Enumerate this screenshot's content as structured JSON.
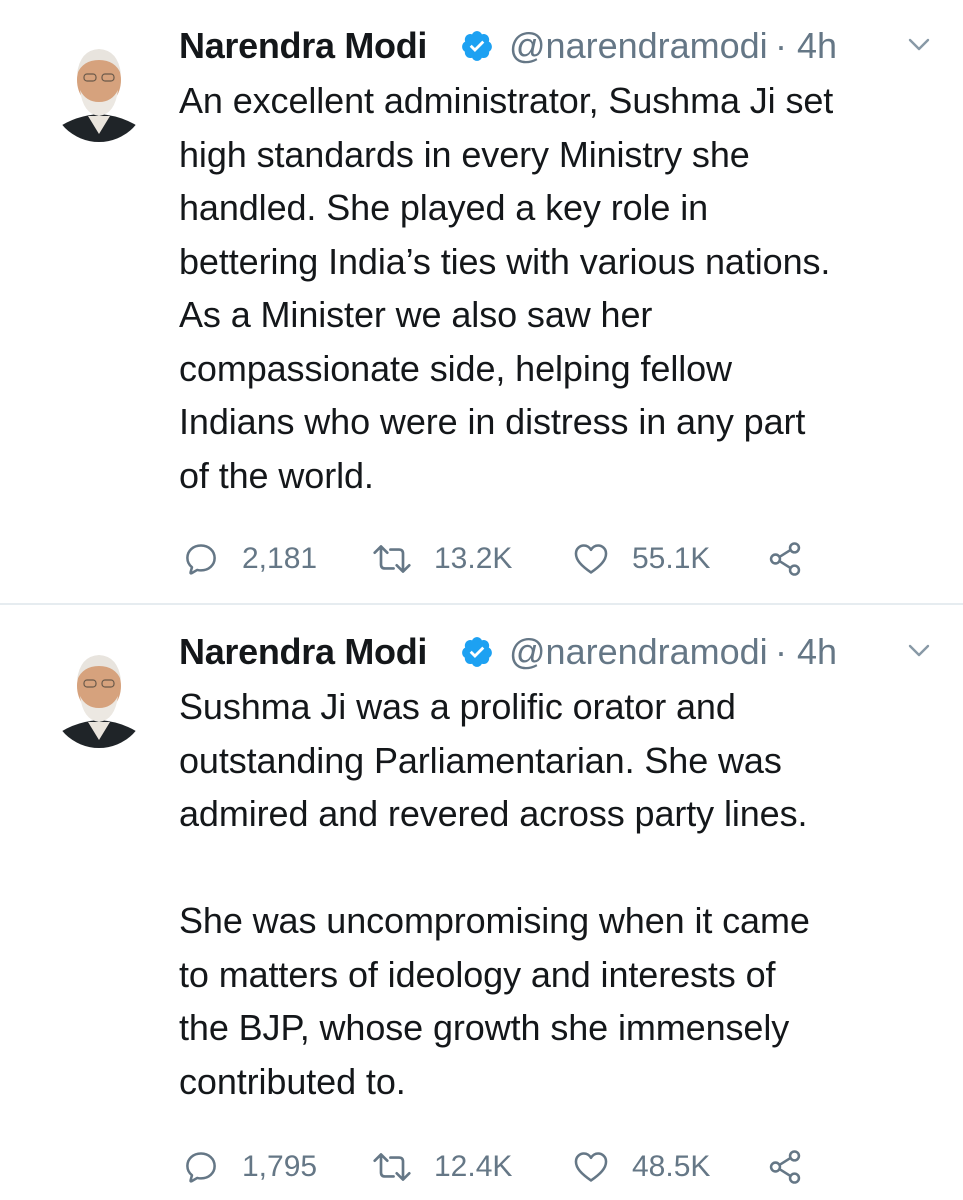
{
  "tweets": [
    {
      "author": {
        "name": "Narendra Modi",
        "handle": "@narendramodi",
        "verified": true
      },
      "separator": "·",
      "time": "4h",
      "body": [
        "An excellent administrator, Sushma Ji set\nhigh standards in every Ministry she\nhandled. She played a key role in\nbettering India’s ties with various nations.\nAs a Minister we also saw her\ncompassionate side, helping fellow\nIndians who were in distress in any part\nof the world."
      ],
      "stats": {
        "replies": "2,181",
        "retweets": "13.2K",
        "likes": "55.1K"
      }
    },
    {
      "author": {
        "name": "Narendra Modi",
        "handle": "@narendramodi",
        "verified": true
      },
      "separator": "·",
      "time": "4h",
      "body": [
        "Sushma Ji was a prolific orator and\noutstanding Parliamentarian. She was\nadmired and revered across party lines.",
        "She was uncompromising when it came\nto matters of ideology and interests of\nthe BJP, whose growth she immensely\ncontributed to."
      ],
      "stats": {
        "replies": "1,795",
        "retweets": "12.4K",
        "likes": "48.5K"
      }
    }
  ],
  "icons": {
    "verified": "verified-badge-icon",
    "caret": "chevron-down-icon",
    "reply": "reply-icon",
    "retweet": "retweet-icon",
    "like": "heart-icon",
    "share": "share-icon"
  },
  "colors": {
    "text": "#14171a",
    "secondary": "#657786",
    "verified": "#1da1f2",
    "divider": "#e6ecf0"
  }
}
